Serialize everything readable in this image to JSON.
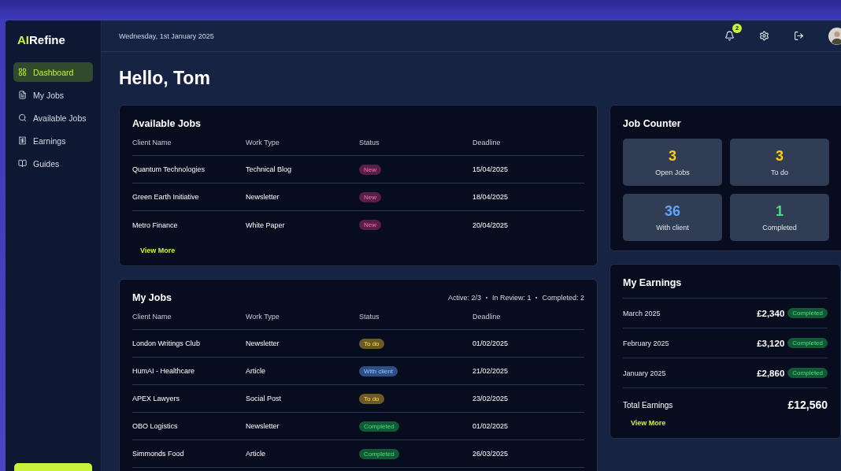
{
  "brand": {
    "accent": "AI",
    "rest": "Refine"
  },
  "sidebar": {
    "items": [
      {
        "label": "Dashboard",
        "kind": "grid",
        "selected": true
      },
      {
        "label": "My Jobs",
        "kind": "file",
        "selected": false
      },
      {
        "label": "Available Jobs",
        "kind": "search",
        "selected": false
      },
      {
        "label": "Earnings",
        "kind": "ledger",
        "selected": false
      },
      {
        "label": "Guides",
        "kind": "book",
        "selected": false
      }
    ]
  },
  "header": {
    "date": "Wednesday, 1st January 2025",
    "notifications": "2"
  },
  "greeting": "Hello, Tom",
  "available_jobs": {
    "title": "Available Jobs",
    "columns": [
      "Client Name",
      "Work Type",
      "Status",
      "Deadline"
    ],
    "rows": [
      {
        "client": "Quantum Technologies",
        "type": "Technical Blog",
        "status": "New",
        "kind": "new",
        "deadline": "15/04/2025"
      },
      {
        "client": "Green Earth Initiative",
        "type": "Newsletter",
        "status": "New",
        "kind": "new",
        "deadline": "18/04/2025"
      },
      {
        "client": "Metro Finance",
        "type": "White Paper",
        "status": "New",
        "kind": "new",
        "deadline": "20/04/2025"
      }
    ],
    "link": "View More"
  },
  "my_jobs": {
    "title": "My Jobs",
    "summary": [
      "Active: 2/3",
      "In Review: 1",
      "Completed: 2"
    ],
    "columns": [
      "Client Name",
      "Work Type",
      "Status",
      "Deadline"
    ],
    "rows": [
      {
        "client": "London Writings Club",
        "type": "Newsletter",
        "status": "To do",
        "kind": "todo",
        "deadline": "01/02/2025"
      },
      {
        "client": "HumAI - Healthcare",
        "type": "Article",
        "status": "With client",
        "kind": "client",
        "deadline": "21/02/2025"
      },
      {
        "client": "APEX Lawyers",
        "type": "Social Post",
        "status": "To do",
        "kind": "todo",
        "deadline": "23/02/2025"
      },
      {
        "client": "OBO Logistics",
        "type": "Newsletter",
        "status": "Completed",
        "kind": "completed",
        "deadline": "01/02/2025"
      },
      {
        "client": "Simmonds Food",
        "type": "Article",
        "status": "Completed",
        "kind": "completed",
        "deadline": "26/03/2025"
      }
    ]
  },
  "job_counter": {
    "title": "Job Counter",
    "items": [
      {
        "value": "3",
        "label": "Open Jobs",
        "color": "#facc15"
      },
      {
        "value": "3",
        "label": "To do",
        "color": "#facc15"
      },
      {
        "value": "36",
        "label": "With client",
        "color": "#60a5fa"
      },
      {
        "value": "1",
        "label": "Completed",
        "color": "#4ade80"
      }
    ]
  },
  "earnings": {
    "title": "My Earnings",
    "rows": [
      {
        "month": "March 2025",
        "amount": "£2,340",
        "status": "Completed",
        "kind": "completed"
      },
      {
        "month": "February 2025",
        "amount": "£3,120",
        "status": "Completed",
        "kind": "completed"
      },
      {
        "month": "January 2025",
        "amount": "£2,860",
        "status": "Completed",
        "kind": "completed"
      }
    ],
    "total_label": "Total Earnings",
    "total": "£12,560",
    "link": "View More"
  }
}
